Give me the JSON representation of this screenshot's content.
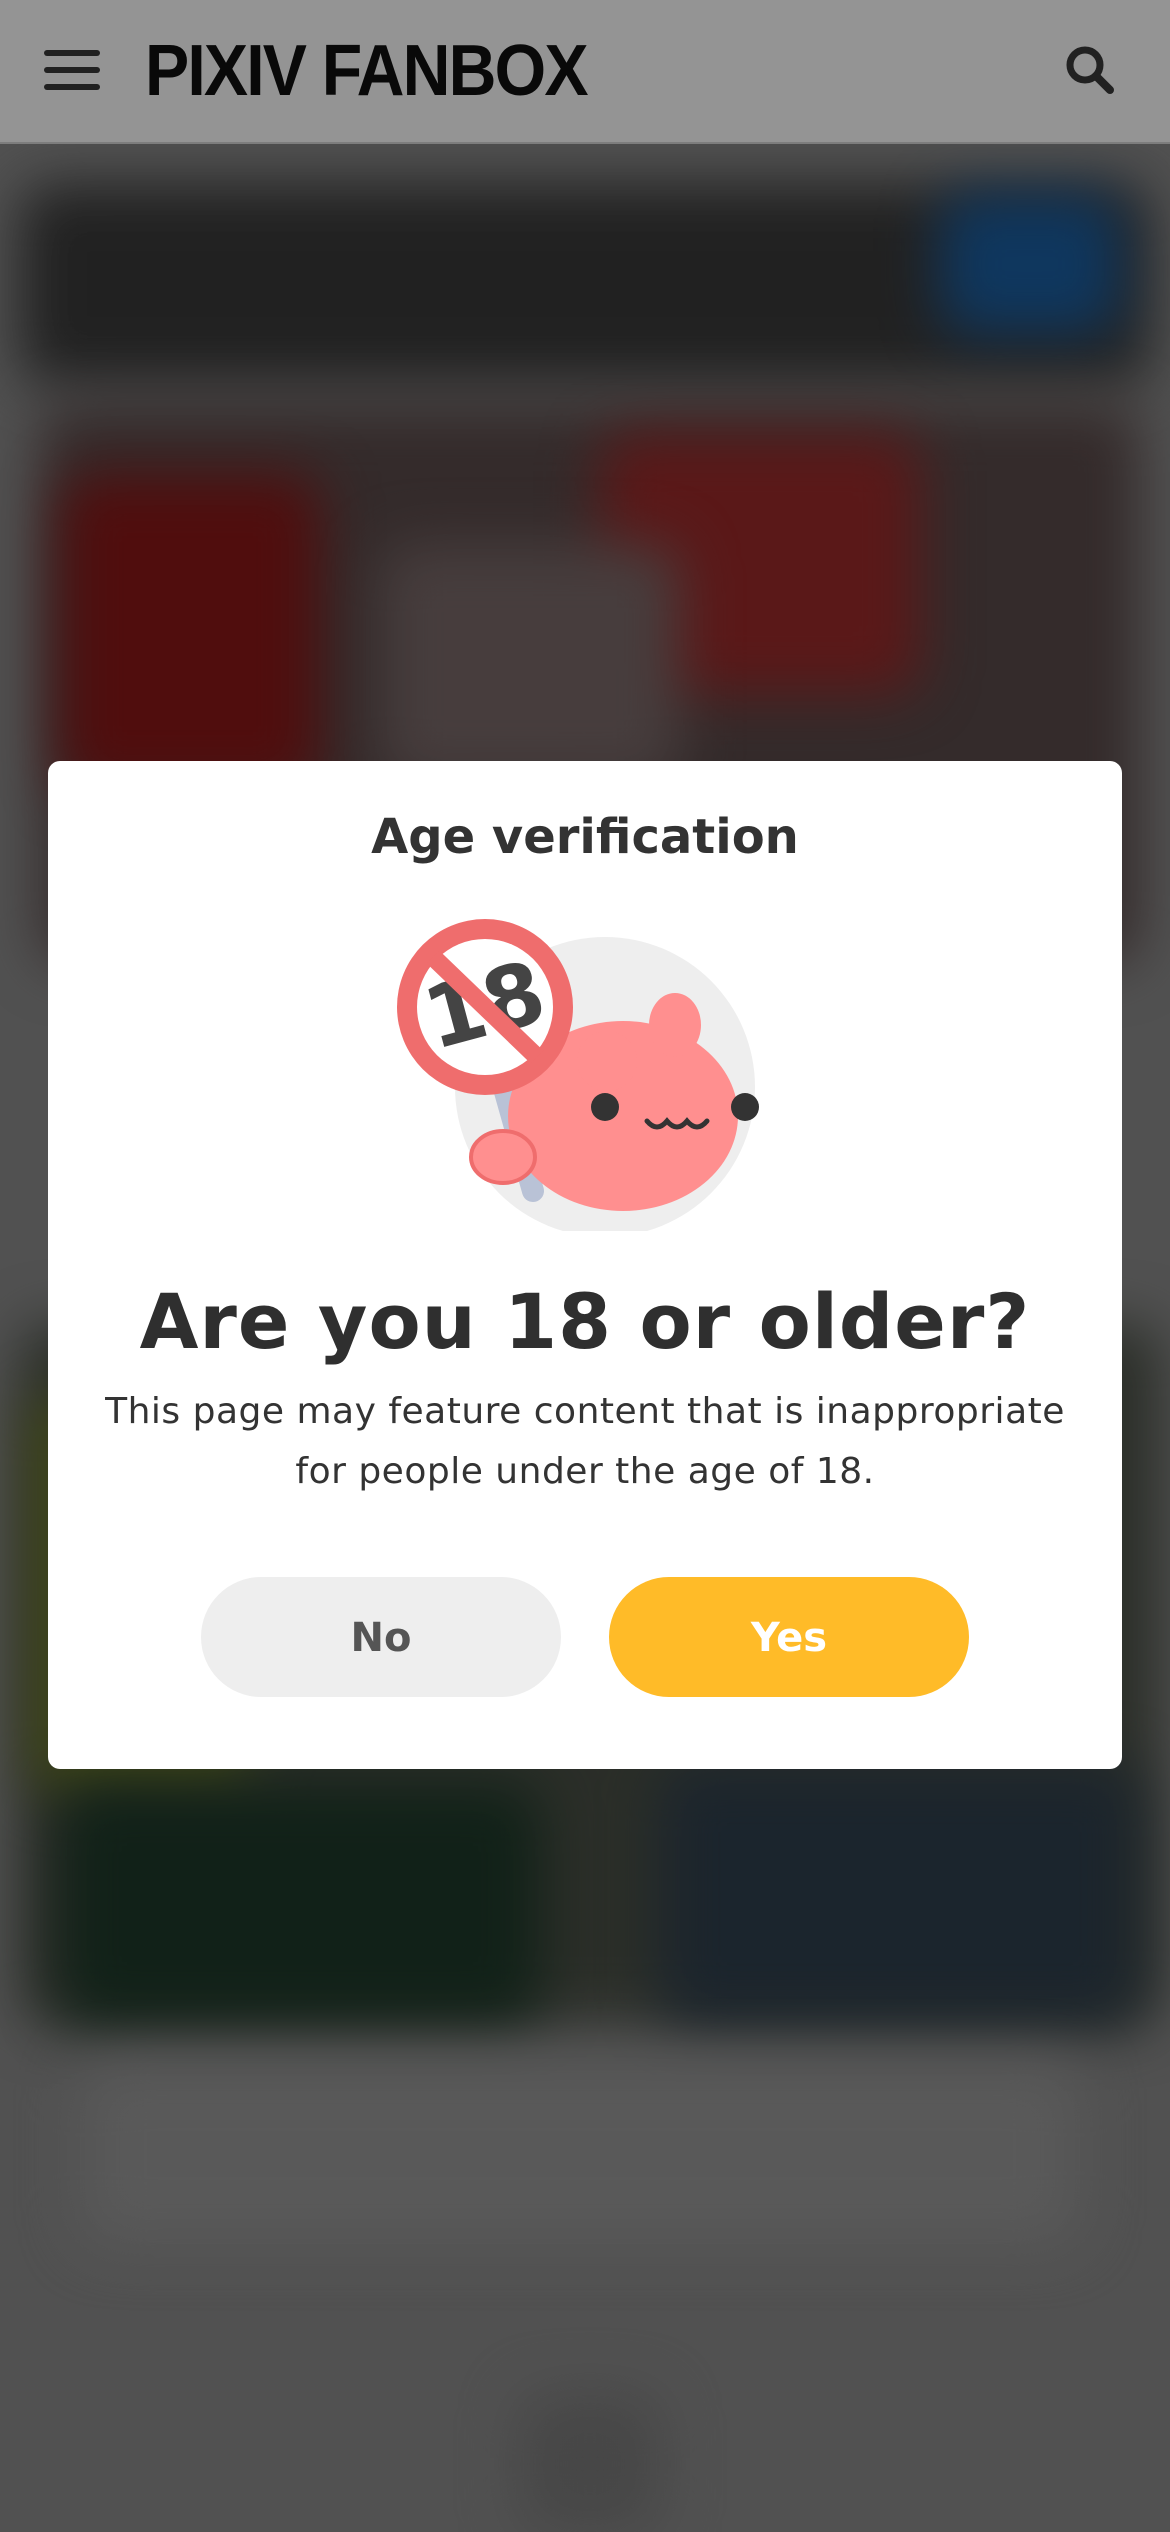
{
  "header": {
    "logo_text": "PIXIV FANBOX",
    "menu_icon": "hamburger-menu-icon",
    "search_icon": "search-icon"
  },
  "modal": {
    "title": "Age verification",
    "illustration": "age-restriction-18-mascot-icon",
    "question": "Are you 18 or older?",
    "description": "This page may feature content that is inappropriate for people under the age of 18.",
    "no_label": "No",
    "yes_label": "Yes"
  },
  "colors": {
    "accent": "#ffbb28",
    "no_button_bg": "#eeeeee",
    "restriction_red": "#ef6d6d",
    "mascot_pink": "#ff8f8f"
  }
}
